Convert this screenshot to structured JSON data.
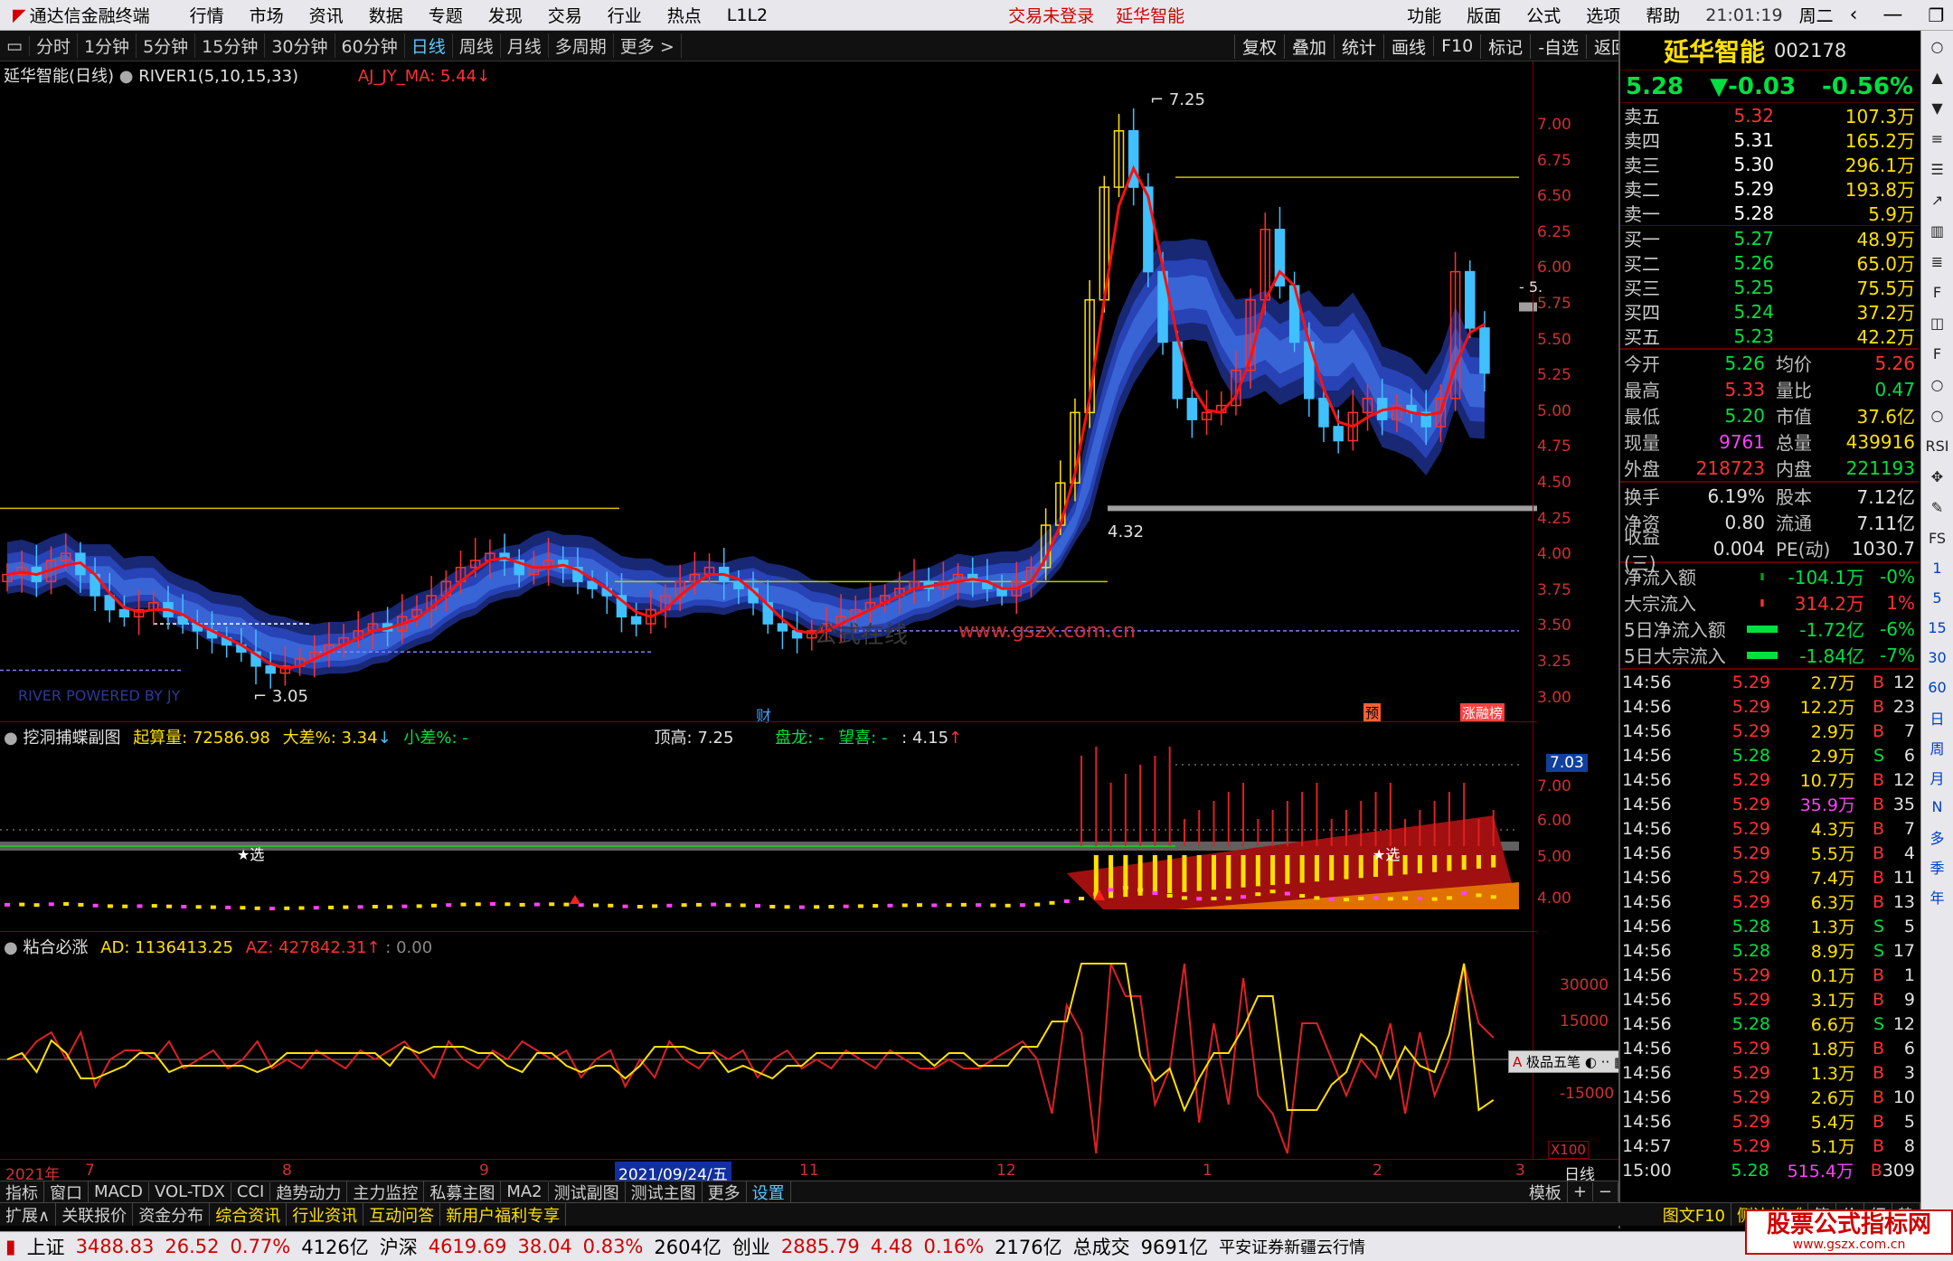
{
  "titlebar": {
    "app": "通达信金融终端",
    "menus": [
      "行情",
      "市场",
      "资讯",
      "数据",
      "专题",
      "发现",
      "交易",
      "行业",
      "热点",
      "L1L2"
    ],
    "center": [
      "交易未登录",
      "延华智能"
    ],
    "right": [
      "功能",
      "版面",
      "公式",
      "选项",
      "帮助"
    ],
    "clock": "21:01:19",
    "weekday": "周二"
  },
  "periods": [
    "分时",
    "1分钟",
    "5分钟",
    "15分钟",
    "30分钟",
    "60分钟",
    "日线",
    "周线",
    "月线",
    "多周期",
    "更多 >"
  ],
  "active_period": "日线",
  "tools": [
    "复权",
    "叠加",
    "统计",
    "画线",
    "F10",
    "标记",
    "-自选",
    "返回"
  ],
  "main": {
    "title": "延华智能(日线)",
    "indicator": "RIVER1(5,10,15,33)",
    "ma": "AJ_JY_MA: 5.44",
    "high_label": "7.25",
    "low_label": "3.05",
    "label_432": "4.32",
    "label_right": "5.",
    "river_tag": "RIVER POWERED BY JY",
    "site": "www.gszx.com.cn",
    "site_cn": "公式在线",
    "markers": [
      "财",
      "预",
      "涨",
      "融",
      "榜"
    ],
    "yaxis": [
      "7.00",
      "6.75",
      "6.50",
      "6.25",
      "6.00",
      "5.75",
      "5.50",
      "5.25",
      "5.00",
      "4.75",
      "4.50",
      "4.25",
      "4.00",
      "3.75",
      "3.50",
      "3.25",
      "3.00"
    ]
  },
  "sub1": {
    "title": "挖洞捕蝶副图",
    "qs": "起算量: 72586.98",
    "dc": "大差%: 3.34",
    "xc": "小差%: -",
    "dg": "顶高: 7.25",
    "pl": "盘龙: -",
    "wx": "望喜: -",
    "v415": ": 4.15",
    "tag": "★选",
    "right_value": "7.03",
    "yaxis": [
      "7.00",
      "6.00",
      "5.00",
      "4.00"
    ]
  },
  "sub2": {
    "title": "粘合必涨",
    "ad": "AD: 1136413.25",
    "az": "AZ: 427842.31",
    "zero": ": 0.00",
    "yaxis": [
      "30000",
      "15000",
      "-15000"
    ],
    "unit": "X100",
    "popup": "极品五笔"
  },
  "dates": [
    "2021年",
    "7",
    "8",
    "9",
    "2021/09/24/五",
    "11",
    "12",
    "1",
    "2",
    "3",
    "日线"
  ],
  "stock": {
    "name": "延华智能",
    "code": "002178",
    "price": "5.28",
    "change": "▼-0.03",
    "pct": "-0.56%"
  },
  "orderbook": {
    "sell": [
      {
        "l": "卖五",
        "p": "5.32",
        "v": "107.3万"
      },
      {
        "l": "卖四",
        "p": "5.31",
        "v": "165.2万"
      },
      {
        "l": "卖三",
        "p": "5.30",
        "v": "296.1万"
      },
      {
        "l": "卖二",
        "p": "5.29",
        "v": "193.8万"
      },
      {
        "l": "卖一",
        "p": "5.28",
        "v": "5.9万"
      }
    ],
    "buy": [
      {
        "l": "买一",
        "p": "5.27",
        "v": "48.9万"
      },
      {
        "l": "买二",
        "p": "5.26",
        "v": "65.0万"
      },
      {
        "l": "买三",
        "p": "5.25",
        "v": "75.5万"
      },
      {
        "l": "买四",
        "p": "5.24",
        "v": "37.2万"
      },
      {
        "l": "买五",
        "p": "5.23",
        "v": "42.2万"
      }
    ]
  },
  "quote": [
    {
      "a": "今开",
      "b": "5.26",
      "c": "均价",
      "d": "5.26"
    },
    {
      "a": "最高",
      "b": "5.33",
      "c": "量比",
      "d": "0.47"
    },
    {
      "a": "最低",
      "b": "5.20",
      "c": "市值",
      "d": "37.6亿"
    },
    {
      "a": "现量",
      "b": "9761",
      "c": "总量",
      "d": "439916"
    },
    {
      "a": "外盘",
      "b": "218723",
      "c": "内盘",
      "d": "221193"
    }
  ],
  "fund": [
    {
      "a": "换手",
      "b": "6.19%",
      "c": "股本",
      "d": "7.12亿"
    },
    {
      "a": "净资",
      "b": "0.80",
      "c": "流通",
      "d": "7.11亿"
    },
    {
      "a": "收益(三)",
      "b": "0.004",
      "c": "PE(动)",
      "d": "1030.7"
    }
  ],
  "flow": [
    {
      "a": "净流入额",
      "v": "-104.1万",
      "p": "-0%"
    },
    {
      "a": "大宗流入",
      "v": "314.2万",
      "p": "1%"
    },
    {
      "a": "5日净流入额",
      "v": "-1.72亿",
      "p": "-6%"
    },
    {
      "a": "5日大宗流入",
      "v": "-1.84亿",
      "p": "-7%"
    }
  ],
  "trades": [
    [
      "14:56",
      "5.29",
      "2.7万",
      "B",
      "12"
    ],
    [
      "14:56",
      "5.29",
      "12.2万",
      "B",
      "23"
    ],
    [
      "14:56",
      "5.29",
      "2.9万",
      "B",
      "7"
    ],
    [
      "14:56",
      "5.28",
      "2.9万",
      "S",
      "6"
    ],
    [
      "14:56",
      "5.29",
      "10.7万",
      "B",
      "12"
    ],
    [
      "14:56",
      "5.29",
      "35.9万",
      "B",
      "35"
    ],
    [
      "14:56",
      "5.29",
      "4.3万",
      "B",
      "7"
    ],
    [
      "14:56",
      "5.29",
      "5.5万",
      "B",
      "4"
    ],
    [
      "14:56",
      "5.29",
      "7.4万",
      "B",
      "11"
    ],
    [
      "14:56",
      "5.29",
      "6.3万",
      "B",
      "13"
    ],
    [
      "14:56",
      "5.28",
      "1.3万",
      "S",
      "5"
    ],
    [
      "14:56",
      "5.28",
      "8.9万",
      "S",
      "17"
    ],
    [
      "14:56",
      "5.29",
      "0.1万",
      "B",
      "1"
    ],
    [
      "14:56",
      "5.29",
      "3.1万",
      "B",
      "9"
    ],
    [
      "14:56",
      "5.28",
      "6.6万",
      "S",
      "12"
    ],
    [
      "14:56",
      "5.29",
      "1.8万",
      "B",
      "6"
    ],
    [
      "14:56",
      "5.29",
      "1.3万",
      "B",
      "3"
    ],
    [
      "14:56",
      "5.29",
      "2.6万",
      "B",
      "10"
    ],
    [
      "14:56",
      "5.29",
      "5.4万",
      "B",
      "5"
    ],
    [
      "14:57",
      "5.29",
      "5.1万",
      "B",
      "8"
    ],
    [
      "15:00",
      "5.28",
      "515.4万",
      "B",
      "309"
    ]
  ],
  "side": [
    "○",
    "▲",
    "▼",
    "≡",
    "☰",
    "↗",
    "▥",
    "≣",
    "F",
    "◫",
    "F",
    "○",
    "○",
    "RSI",
    "✥",
    "✎",
    "FS",
    "1",
    "5",
    "15",
    "30",
    "60",
    "日",
    "周",
    "月",
    "N",
    "多",
    "季",
    "年"
  ],
  "tabs1": [
    "指标",
    "窗口",
    "MACD",
    "VOL-TDX",
    "CCI",
    "趋势动力",
    "主力监控",
    "私募主图",
    "MA2",
    "测试副图",
    "测试主图",
    "更多",
    "设置"
  ],
  "tabs1_right": [
    "模板",
    "+",
    "−"
  ],
  "tabs2": [
    "扩展∧",
    "关联报价",
    "资金分布",
    "综合资讯",
    "行业资讯",
    "互动问答",
    "新用户福利专享"
  ],
  "tabs2_right": [
    "图文F10",
    "侧边栏《",
    "笔",
    "价",
    "细",
    "势"
  ],
  "status": {
    "sh": "上证",
    "sh_v": "3488.83",
    "sh_c": "26.52",
    "sh_p": "0.77%",
    "sh_a": "4126亿",
    "sz": "沪深",
    "sz_v": "4619.69",
    "sz_c": "38.04",
    "sz_p": "0.83%",
    "sz_a": "2604亿",
    "cy": "创业",
    "cy_v": "2885.79",
    "cy_c": "4.48",
    "cy_p": "0.16%",
    "cy_a": "2176亿",
    "tot": "总成交",
    "tot_v": "9691亿",
    "broker": "平安证券新疆云行情"
  },
  "logo": {
    "a": "股票公式指标网",
    "b": "www.gszx.com.cn"
  },
  "chart_data": {
    "type": "candlestick",
    "ylim": [
      3.0,
      7.3
    ],
    "closes": [
      3.85,
      3.9,
      3.8,
      3.95,
      4.0,
      3.85,
      3.7,
      3.6,
      3.55,
      3.6,
      3.65,
      3.55,
      3.5,
      3.45,
      3.4,
      3.35,
      3.3,
      3.2,
      3.15,
      3.2,
      3.25,
      3.3,
      3.35,
      3.4,
      3.45,
      3.5,
      3.45,
      3.55,
      3.6,
      3.7,
      3.8,
      3.9,
      3.95,
      4.0,
      3.95,
      3.85,
      3.9,
      3.95,
      3.9,
      3.8,
      3.75,
      3.7,
      3.55,
      3.5,
      3.6,
      3.7,
      3.8,
      3.85,
      3.9,
      3.8,
      3.75,
      3.65,
      3.5,
      3.45,
      3.4,
      3.45,
      3.5,
      3.55,
      3.6,
      3.65,
      3.7,
      3.75,
      3.8,
      3.75,
      3.8,
      3.85,
      3.8,
      3.75,
      3.7,
      3.8,
      3.9,
      4.2,
      4.5,
      5.0,
      5.8,
      6.6,
      7.0,
      6.6,
      6.0,
      5.5,
      5.1,
      4.95,
      5.0,
      5.05,
      5.3,
      5.8,
      6.3,
      5.9,
      5.5,
      5.1,
      4.9,
      4.8,
      5.0,
      5.1,
      4.95,
      5.05,
      5.0,
      4.9,
      5.1,
      6.0,
      5.6,
      5.28
    ]
  }
}
